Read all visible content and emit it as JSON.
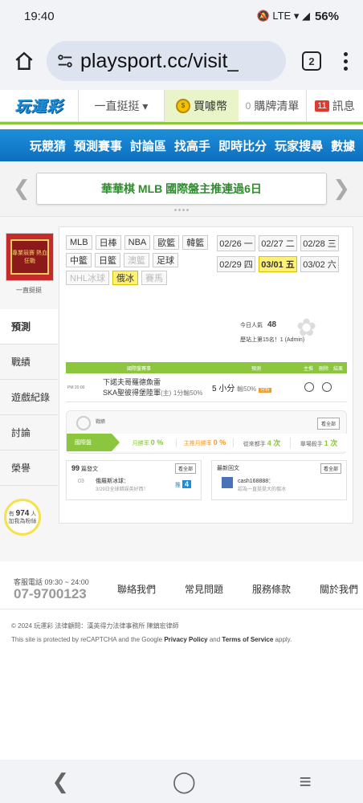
{
  "status_bar": {
    "time": "19:40",
    "icons": "🔕 LTE ▾ ◢",
    "battery": "56%"
  },
  "browser": {
    "url": "playsport.cc/visit_",
    "tab_count": "2"
  },
  "site_header": {
    "logo": "玩運彩",
    "user_menu": "一直挺挺 ▾",
    "buy_coins": "買噱幣",
    "cart_count": "0",
    "cart_label": "購牌清單",
    "msg_count": "11",
    "msg_label": "訊息"
  },
  "main_nav": [
    "玩競猜",
    "預測賽事",
    "討論區",
    "找高手",
    "即時比分",
    "玩家搜尋",
    "數據"
  ],
  "ticker": {
    "text": "華華棋 MLB 國際盤主推連過6日"
  },
  "profile": {
    "nickname": "一直挺挺",
    "avatar_text": "專業競賽 熱血狂戰"
  },
  "side_nav": [
    "預測",
    "戰績",
    "遊戲紀錄",
    "討論",
    "榮譽"
  ],
  "fan_bubble": {
    "prefix": "有",
    "count": "974",
    "suffix": "人",
    "line2": "加我為粉絲"
  },
  "league_tags": [
    {
      "label": "MLB",
      "state": "normal"
    },
    {
      "label": "日棒",
      "state": "normal"
    },
    {
      "label": "NBA",
      "state": "normal"
    },
    {
      "label": "歐籃",
      "state": "normal"
    },
    {
      "label": "韓籃",
      "state": "normal"
    },
    {
      "label": "中籃",
      "state": "normal"
    },
    {
      "label": "日籃",
      "state": "normal"
    },
    {
      "label": "澳籃",
      "state": "disabled"
    },
    {
      "label": "足球",
      "state": "normal"
    },
    {
      "label": "NHL冰球",
      "state": "disabled"
    },
    {
      "label": "俄冰",
      "state": "active"
    },
    {
      "label": "賽馬",
      "state": "disabled"
    }
  ],
  "dates": [
    {
      "label": "02/26 一",
      "active": false
    },
    {
      "label": "02/27 二",
      "active": false
    },
    {
      "label": "02/28 三",
      "active": false
    },
    {
      "label": "02/29 四",
      "active": false
    },
    {
      "label": "03/01 五",
      "active": true
    },
    {
      "label": "03/02 六",
      "active": false
    }
  ],
  "popularity": {
    "label": "今日人氣",
    "value": "48"
  },
  "ranking": {
    "text": "歷站上第15名！1 (Admin)"
  },
  "prediction_table": {
    "headers": [
      "國際盤賽事",
      "預測",
      "主推",
      "刪除",
      "結果"
    ],
    "row": {
      "time": "PM 20:00",
      "game_line1": "下諾夫哥羅德魚雷",
      "game_line2": "SKA聖彼得堡陸軍",
      "game_tag": "(主)",
      "game_result": "1分輸50%",
      "pick": "5 小分",
      "pick_detail": "輸50%",
      "pick_badge": "分析"
    }
  },
  "stats": {
    "title": "戰績",
    "all_button": "看全部",
    "label": "國際盤",
    "month_win": "月勝率",
    "month_win_value": "0 %",
    "main_win": "主推月勝率",
    "main_win_value": "0 %",
    "streak": "從來都手",
    "streak_value": "4 次",
    "single": "單場殺手",
    "single_value": "1 次"
  },
  "posts_box": {
    "count": "99",
    "label": "篇發文",
    "button": "看全部",
    "index": "03",
    "title": "俄羅斯冰球：",
    "subtitle": "3/29日全球錯誤英好西！",
    "recommend_label": "推",
    "recommend_value": "4"
  },
  "replies_box": {
    "label": "最新回文",
    "button": "看全部",
    "user": "cash168888：",
    "text": "認為一直挺挺大的俄冰"
  },
  "footer": {
    "service_hours": "客服電話 09:30 ~ 24:00",
    "phone": "07-9700123",
    "links": [
      "聯絡我們",
      "常見問題",
      "服務條款",
      "關於我們"
    ],
    "copyright": "© 2024 玩運彩 法律顧問：漢英得力法律事務所 陳鎮宏律師",
    "recaptcha_pre": "This site is protected by reCAPTCHA and the Google",
    "privacy": "Privacy Policy",
    "and": "and",
    "terms": "Terms of Service",
    "apply": "apply."
  },
  "colors": {
    "brand_blue": "#1d8fd9",
    "brand_green": "#8cc63f",
    "highlight_yellow": "#fff176",
    "alert_red": "#e03a2e"
  }
}
